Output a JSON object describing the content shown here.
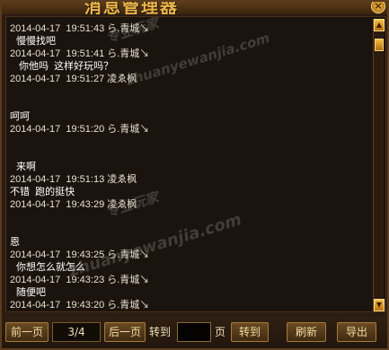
{
  "window": {
    "title": "消息管理器",
    "close_icon": "close-icon"
  },
  "messages": [
    {
      "header": "2014-04-17  19:51:43 ら.青城↘",
      "body": "慢慢找吧"
    },
    {
      "header": "2014-04-17  19:51:41 ら.青城↘",
      "body": " 你他吗  这样好玩吗？"
    },
    {
      "header": "2014-04-17  19:51:27 凌ゑ枫",
      "body": ""
    },
    {
      "header": "",
      "body": "呵呵"
    },
    {
      "header": "2014-04-17  19:51:20 ら.青城↘",
      "body": ""
    },
    {
      "header": "",
      "body": "来啊"
    },
    {
      "header": "2014-04-17  19:51:13 凌ゑ枫",
      "body": "不错  跑的挺快"
    },
    {
      "header": "2014-04-17  19:43:29 凌ゑ枫",
      "body": ""
    },
    {
      "header": "",
      "body": "恩"
    },
    {
      "header": "2014-04-17  19:43:25 ら.青城↘",
      "body": "你想怎么就怎么"
    },
    {
      "header": "2014-04-17  19:43:23 ら.青城↘",
      "body": "随便吧"
    },
    {
      "header": "2014-04-17  19:43:20 ら.青城↘",
      "body": ""
    }
  ],
  "watermarks": [
    "专业玩家",
    "zhuanyewanjia.com"
  ],
  "bottom": {
    "prev_label": "前一页",
    "page_info": "3/4",
    "next_label": "后一页",
    "goto_label": "转到",
    "page_input_value": "",
    "page_unit": "页",
    "goto_button": "转到",
    "refresh_label": "刷新",
    "export_label": "导出"
  },
  "colors": {
    "accent": "#e8b54a",
    "background": "#1b130d",
    "text": "#ffffff"
  }
}
